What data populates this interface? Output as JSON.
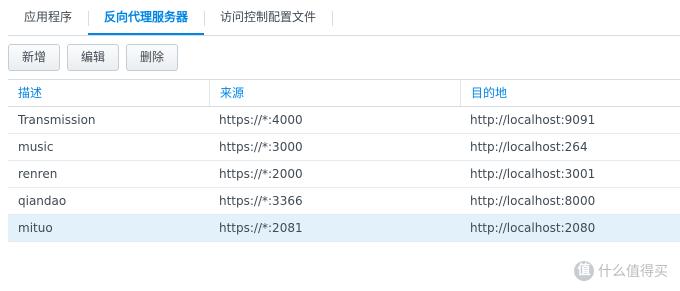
{
  "tabs": [
    {
      "label": "应用程序"
    },
    {
      "label": "反向代理服务器"
    },
    {
      "label": "访问控制配置文件"
    }
  ],
  "toolbar": {
    "create_label": "新增",
    "edit_label": "编辑",
    "delete_label": "删除"
  },
  "table": {
    "headers": [
      "描述",
      "来源",
      "目的地"
    ],
    "rows": [
      [
        "Transmission",
        "https://*:4000",
        "http://localhost:9091"
      ],
      [
        "music",
        "https://*:3000",
        "http://localhost:264"
      ],
      [
        "renren",
        "https://*:2000",
        "http://localhost:3001"
      ],
      [
        "qiandao",
        "https://*:3366",
        "http://localhost:8000"
      ],
      [
        "mituo",
        "https://*:2081",
        "http://localhost:2080"
      ]
    ]
  },
  "watermark": {
    "badge": "值",
    "text": "什么值得买"
  },
  "colors": {
    "accent": "#0086e5",
    "selected_row": "#e3f1fb"
  }
}
